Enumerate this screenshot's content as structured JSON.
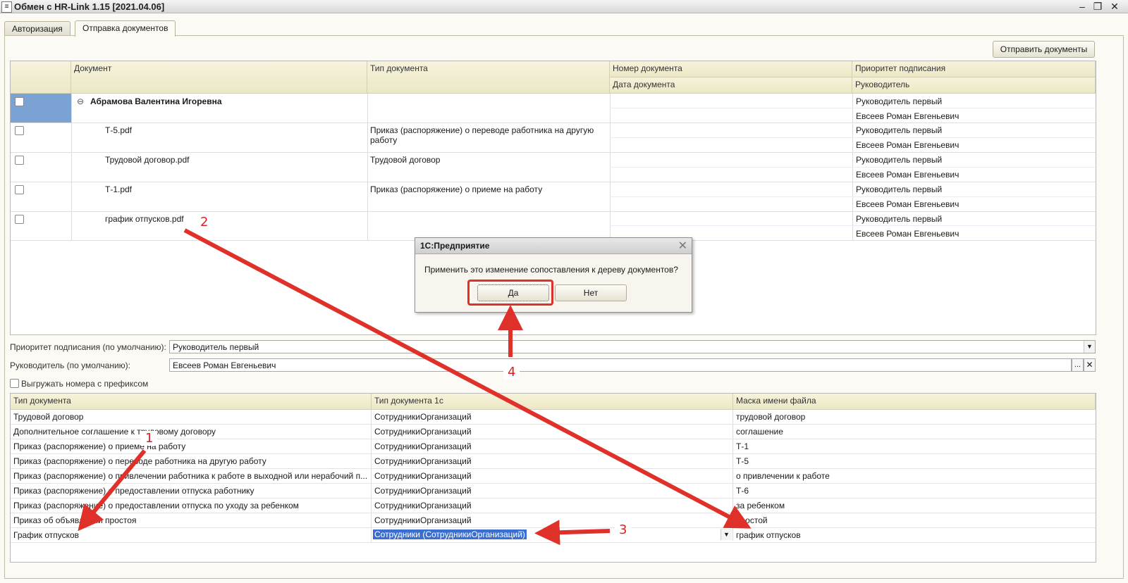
{
  "window": {
    "title": "Обмен с HR-Link 1.15 [2021.04.06]",
    "app_icon": "1c-doc-icon"
  },
  "tabs": [
    {
      "label": "Авторизация"
    },
    {
      "label": "Отправка документов"
    }
  ],
  "send_button": "Отправить документы",
  "doc_grid": {
    "headers": {
      "document": "Документ",
      "doc_type": "Тип документа",
      "doc_number": "Номер документа",
      "doc_date": "Дата документа",
      "priority": "Приоритет подписания",
      "manager": "Руководитель"
    },
    "group": {
      "name": "Абрамова Валентина Игоревна",
      "priority": "Руководитель первый",
      "manager": "Евсеев Роман Евгеньевич"
    },
    "rows": [
      {
        "name": "Т-5.pdf",
        "type": "Приказ (распоряжение) о переводе работника на другую",
        "type2": "работу",
        "priority": "Руководитель первый",
        "manager": "Евсеев Роман Евгеньевич"
      },
      {
        "name": "Трудовой договор.pdf",
        "type": "Трудовой договор",
        "type2": "",
        "priority": "Руководитель первый",
        "manager": "Евсеев Роман Евгеньевич"
      },
      {
        "name": "Т-1.pdf",
        "type": "Приказ (распоряжение) о приеме на работу",
        "type2": "",
        "priority": "Руководитель первый",
        "manager": "Евсеев Роман Евгеньевич"
      },
      {
        "name": "график отпусков.pdf",
        "type": "",
        "type2": "",
        "priority": "Руководитель первый",
        "manager": "Евсеев Роман Евгеньевич"
      }
    ]
  },
  "defaults": {
    "priority_label": "Приоритет подписания (по умолчанию):",
    "priority_value": "Руководитель первый",
    "manager_label": "Руководитель (по умолчанию):",
    "manager_value": "Евсеев Роман Евгеньевич",
    "prefix_checkbox": "Выгружать номера с префиксом"
  },
  "map_grid": {
    "headers": {
      "doc_type": "Тип документа",
      "doc_type_1c": "Тип документа 1с",
      "mask": "Маска имени файла"
    },
    "rows": [
      {
        "type": "Трудовой договор",
        "type1c": "СотрудникиОрганизаций",
        "mask": "трудовой договор"
      },
      {
        "type": "Дополнительное соглашение к трудовому договору",
        "type1c": "СотрудникиОрганизаций",
        "mask": "соглашение"
      },
      {
        "type": "Приказ (распоряжение) о приеме на работу",
        "type1c": "СотрудникиОрганизаций",
        "mask": "Т-1"
      },
      {
        "type": "Приказ (распоряжение) о переводе работника на другую работу",
        "type1c": "СотрудникиОрганизаций",
        "mask": "Т-5"
      },
      {
        "type": "Приказ (распоряжение) о привлечении работника к работе в выходной или нерабочий п...",
        "type1c": "СотрудникиОрганизаций",
        "mask": "о привлечении к работе"
      },
      {
        "type": "Приказ (распоряжение) о предоставлении отпуска работнику",
        "type1c": "СотрудникиОрганизаций",
        "mask": "Т-6"
      },
      {
        "type": "Приказ (распоряжение) о предоставлении отпуска по уходу за ребенком",
        "type1c": "СотрудникиОрганизаций",
        "mask": "за ребенком"
      },
      {
        "type": "Приказ об объявлении простоя",
        "type1c": "СотрудникиОрганизаций",
        "mask": "простой"
      },
      {
        "type": "График отпусков",
        "type1c": "Сотрудники (СотрудникиОрганизаций)",
        "mask": "график отпусков"
      }
    ]
  },
  "dialog": {
    "title": "1С:Предприятие",
    "message": "Применить это изменение сопоставления к дереву документов?",
    "yes": "Да",
    "no": "Нет"
  },
  "annotations": {
    "n1": "1",
    "n2": "2",
    "n3": "3",
    "n4": "4"
  },
  "colors": {
    "annotation_red": "#e0302a",
    "selection_blue": "#3a6fd0",
    "header_bg": "#f2eed3"
  }
}
